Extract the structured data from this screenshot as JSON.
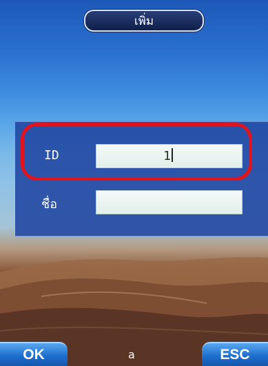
{
  "header": {
    "title": "เพิ่ม"
  },
  "form": {
    "id_label": "ID",
    "id_value": "1",
    "name_label": "ชื่อ",
    "name_value": ""
  },
  "softkeys": {
    "ok_label": "OK",
    "mode_label": "a",
    "esc_label": "ESC"
  },
  "colors": {
    "highlight": "#e0141e",
    "panel": "#2046a0",
    "softkey": "#1e6fd0"
  },
  "icons": {
    "background": "desert-dunes-wallpaper"
  }
}
